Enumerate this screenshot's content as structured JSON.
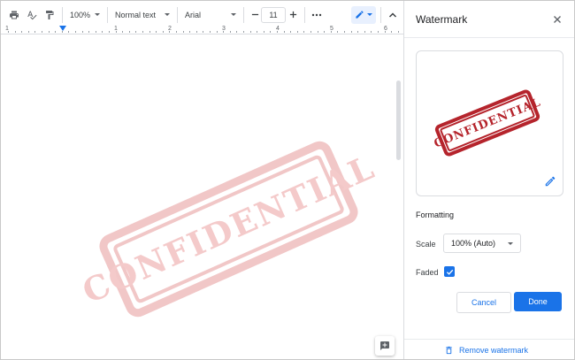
{
  "toolbar": {
    "zoom": "100%",
    "style": "Normal text",
    "font": "Arial",
    "font_size": "11",
    "icons": [
      "print-icon",
      "spellcheck-icon",
      "paint-format-icon",
      "minus-icon",
      "plus-icon",
      "more-icon",
      "pen-icon",
      "collapse-icon"
    ]
  },
  "ruler": {
    "labels": [
      "1",
      "1",
      "2",
      "3",
      "4",
      "5",
      "6"
    ]
  },
  "document": {
    "watermark_text": "CONFIDENTIAL"
  },
  "panel": {
    "title": "Watermark",
    "preview_text": "CONFIDENTIAL",
    "formatting_label": "Formatting",
    "scale_label": "Scale",
    "scale_value": "100% (Auto)",
    "faded_label": "Faded",
    "faded_checked": true,
    "cancel_label": "Cancel",
    "done_label": "Done",
    "remove_label": "Remove watermark",
    "accent_color": "#1a73e8",
    "stamp_color": "#b5242c"
  }
}
